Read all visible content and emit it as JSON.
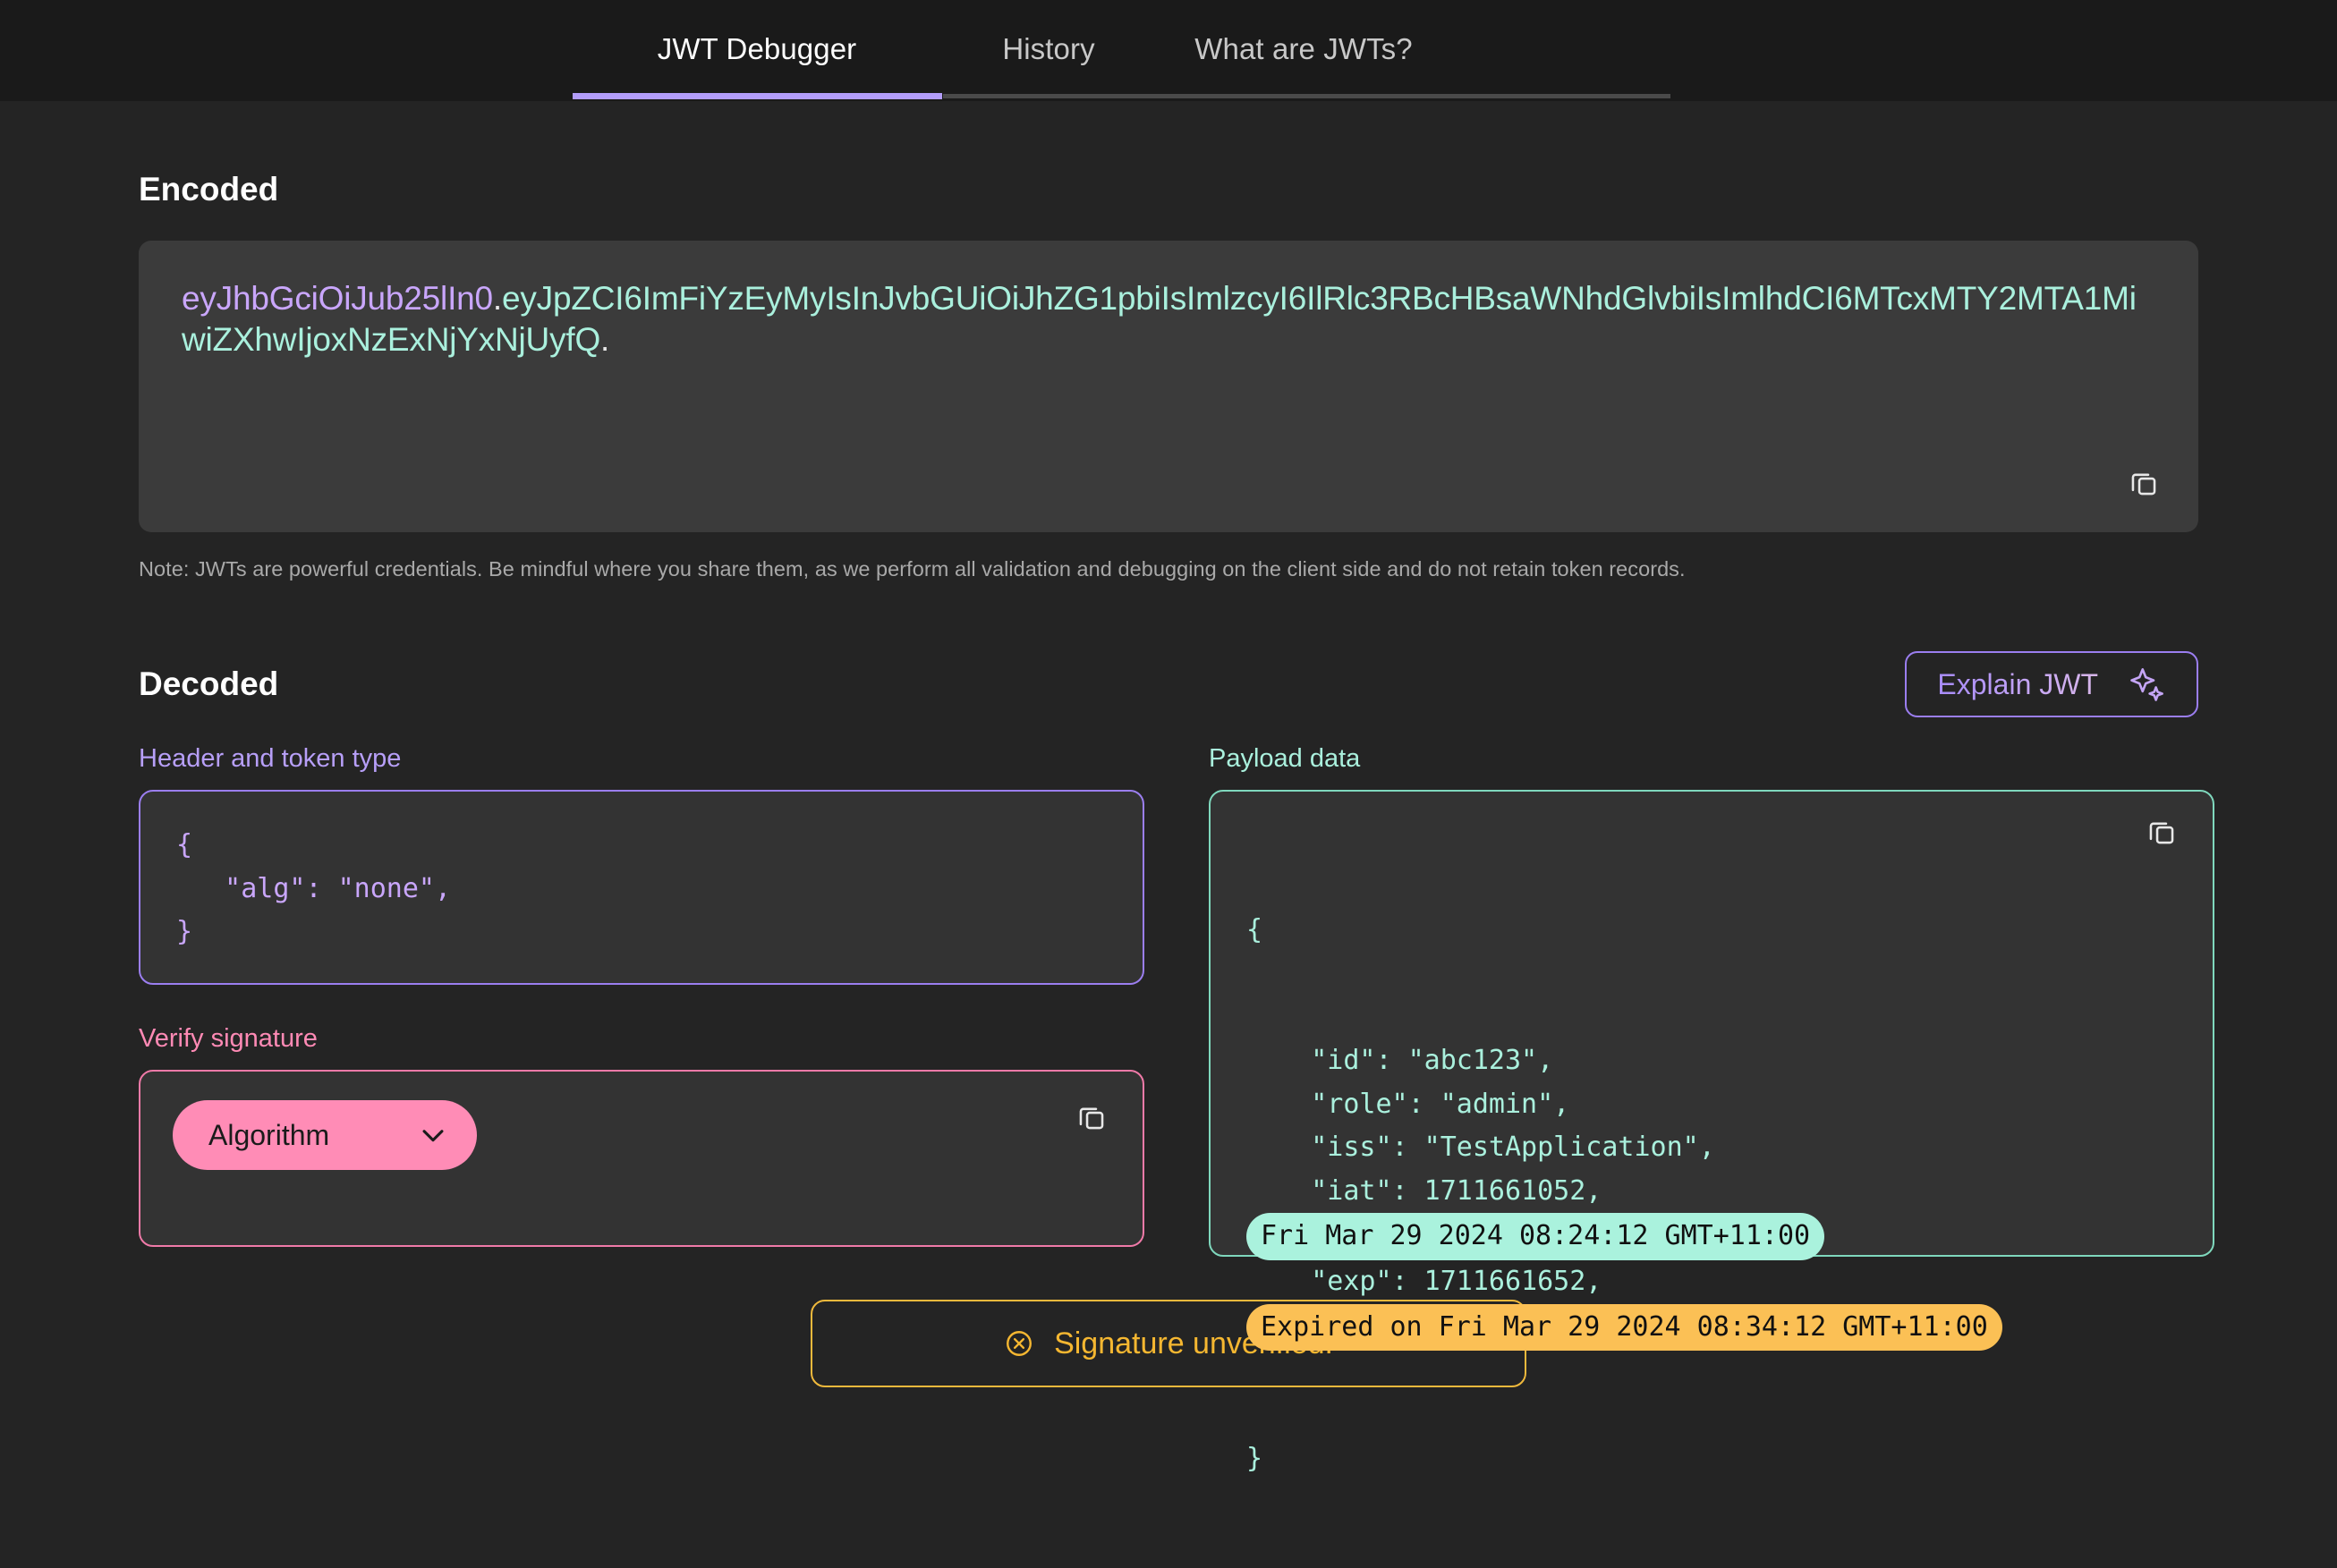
{
  "tabs": [
    {
      "label": "JWT Debugger",
      "active": true
    },
    {
      "label": "History",
      "active": false
    },
    {
      "label": "What are JWTs?",
      "active": false
    }
  ],
  "encoded": {
    "title": "Encoded",
    "token_header": "eyJhbGciOiJub25lIn0",
    "token_sep1": ".",
    "token_payload": "eyJpZCI6ImFiYzEyMyIsInJvbGUiOiJhZG1pbiIsImlzcyI6IlRlc3RBcHBsaWNhdGlvbiIsImlhdCI6MTcxMTY2MTA1MiwiZXhwIjoxNzExNjYxNjUyfQ",
    "token_sep2": ".",
    "copy_icon": "copy-icon",
    "note": "Note: JWTs are powerful credentials. Be mindful where you share them, as we perform all validation and debugging on the client side and do not retain token records."
  },
  "decoded": {
    "title": "Decoded",
    "explain_button": {
      "label": "Explain JWT",
      "icon": "sparkle-icon"
    },
    "header_panel": {
      "label": "Header and token type",
      "code": "{\n   \"alg\": \"none\",\n}"
    },
    "verify_panel": {
      "label": "Verify signature",
      "algorithm_select": "Algorithm",
      "chevron_icon": "chevron-down-icon",
      "copy_icon": "copy-icon"
    },
    "payload_panel": {
      "label": "Payload data",
      "copy_icon": "copy-icon",
      "open_brace": "{",
      "close_brace": "}",
      "lines": [
        {
          "text": "    \"id\": \"abc123\","
        },
        {
          "text": "    \"role\": \"admin\","
        },
        {
          "text": "    \"iss\": \"TestApplication\","
        },
        {
          "text": "    \"iat\": 1711661052,"
        },
        {
          "text": "Fri Mar 29 2024 08:24:12 GMT+11:00",
          "pill": "mint"
        },
        {
          "text": "    \"exp\": 1711661652,"
        },
        {
          "text": "Expired on Fri Mar 29 2024 08:34:12 GMT+11:00",
          "pill": "amber"
        }
      ]
    }
  },
  "status": {
    "label": "Signature unverified!",
    "icon": "circle-x-icon"
  },
  "colors": {
    "accent_purple": "#b39dfa",
    "mint": "#aaf0dd",
    "pink": "#ff8cb6",
    "amber": "#f5b731",
    "page_bg": "#242424",
    "topbar_bg": "#1a1a1a",
    "encoded_bg": "#3b3b3b"
  }
}
